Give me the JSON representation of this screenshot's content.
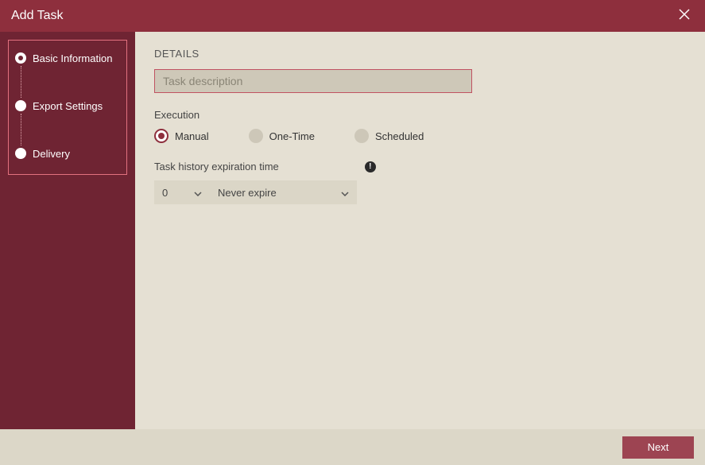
{
  "titlebar": {
    "title": "Add Task"
  },
  "sidebar": {
    "steps": [
      {
        "label": "Basic Information"
      },
      {
        "label": "Export Settings"
      },
      {
        "label": "Delivery"
      }
    ]
  },
  "main": {
    "section_title": "DETAILS",
    "desc_placeholder": "Task description",
    "desc_value": "",
    "execution_label": "Execution",
    "radios": [
      {
        "label": "Manual"
      },
      {
        "label": "One-Time"
      },
      {
        "label": "Scheduled"
      }
    ],
    "expire_label": "Task history expiration time",
    "expire_num": "0",
    "expire_unit": "Never expire"
  },
  "footer": {
    "next": "Next"
  }
}
